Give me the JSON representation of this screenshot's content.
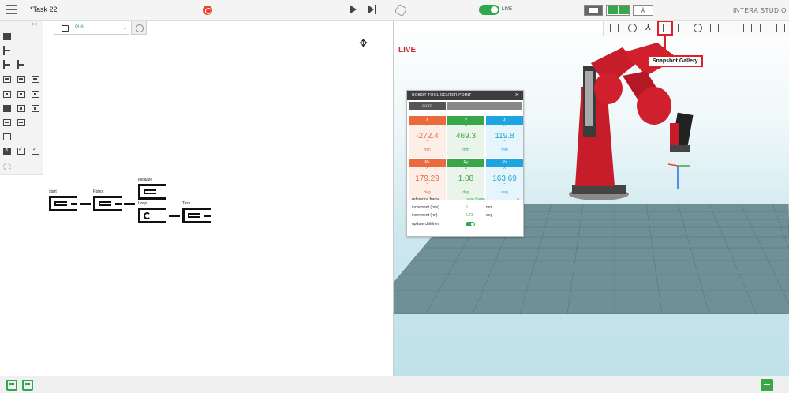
{
  "topbar": {
    "task_title": "*Task 22",
    "live_label": "LIVE",
    "brand": "INTERA STUDIO"
  },
  "left": {
    "collapse_label": "<<",
    "robot_select": {
      "value": "PL6"
    },
    "nodes": {
      "start": "start",
      "robot": "Robot",
      "initialize": "Initialize",
      "loop": "Loop",
      "task": "Task"
    }
  },
  "viewport": {
    "live_text": "LIVE",
    "callout": "Snapshot Gallery",
    "accent": "#e01e2b"
  },
  "tcp": {
    "title": "ROBOT TOOL CENTER POINT",
    "goto": "GO TO",
    "axes": [
      {
        "label": "x",
        "value": "-272.4",
        "unit": "mm",
        "color": "#ea6a3d"
      },
      {
        "label": "y",
        "value": "469.3",
        "unit": "mm",
        "color": "#3aa64a"
      },
      {
        "label": "z",
        "value": "119.8",
        "unit": "mm",
        "color": "#1ea4e0"
      },
      {
        "label": "Rx",
        "value": "179.29",
        "unit": "deg",
        "color": "#ea6a3d"
      },
      {
        "label": "Ry",
        "value": "1.08",
        "unit": "deg",
        "color": "#3aa64a"
      },
      {
        "label": "Rz",
        "value": "163.69",
        "unit": "deg",
        "color": "#1ea4e0"
      }
    ],
    "ref_frame_label": "reference frame",
    "ref_frame_value": "base frame",
    "inc_pos_label": "increment (pos)",
    "inc_pos_value": "5",
    "inc_pos_unit": "mm",
    "inc_rot_label": "increment (rot)",
    "inc_rot_value": "5.73",
    "inc_rot_unit": "deg",
    "update_children_label": "update children"
  }
}
